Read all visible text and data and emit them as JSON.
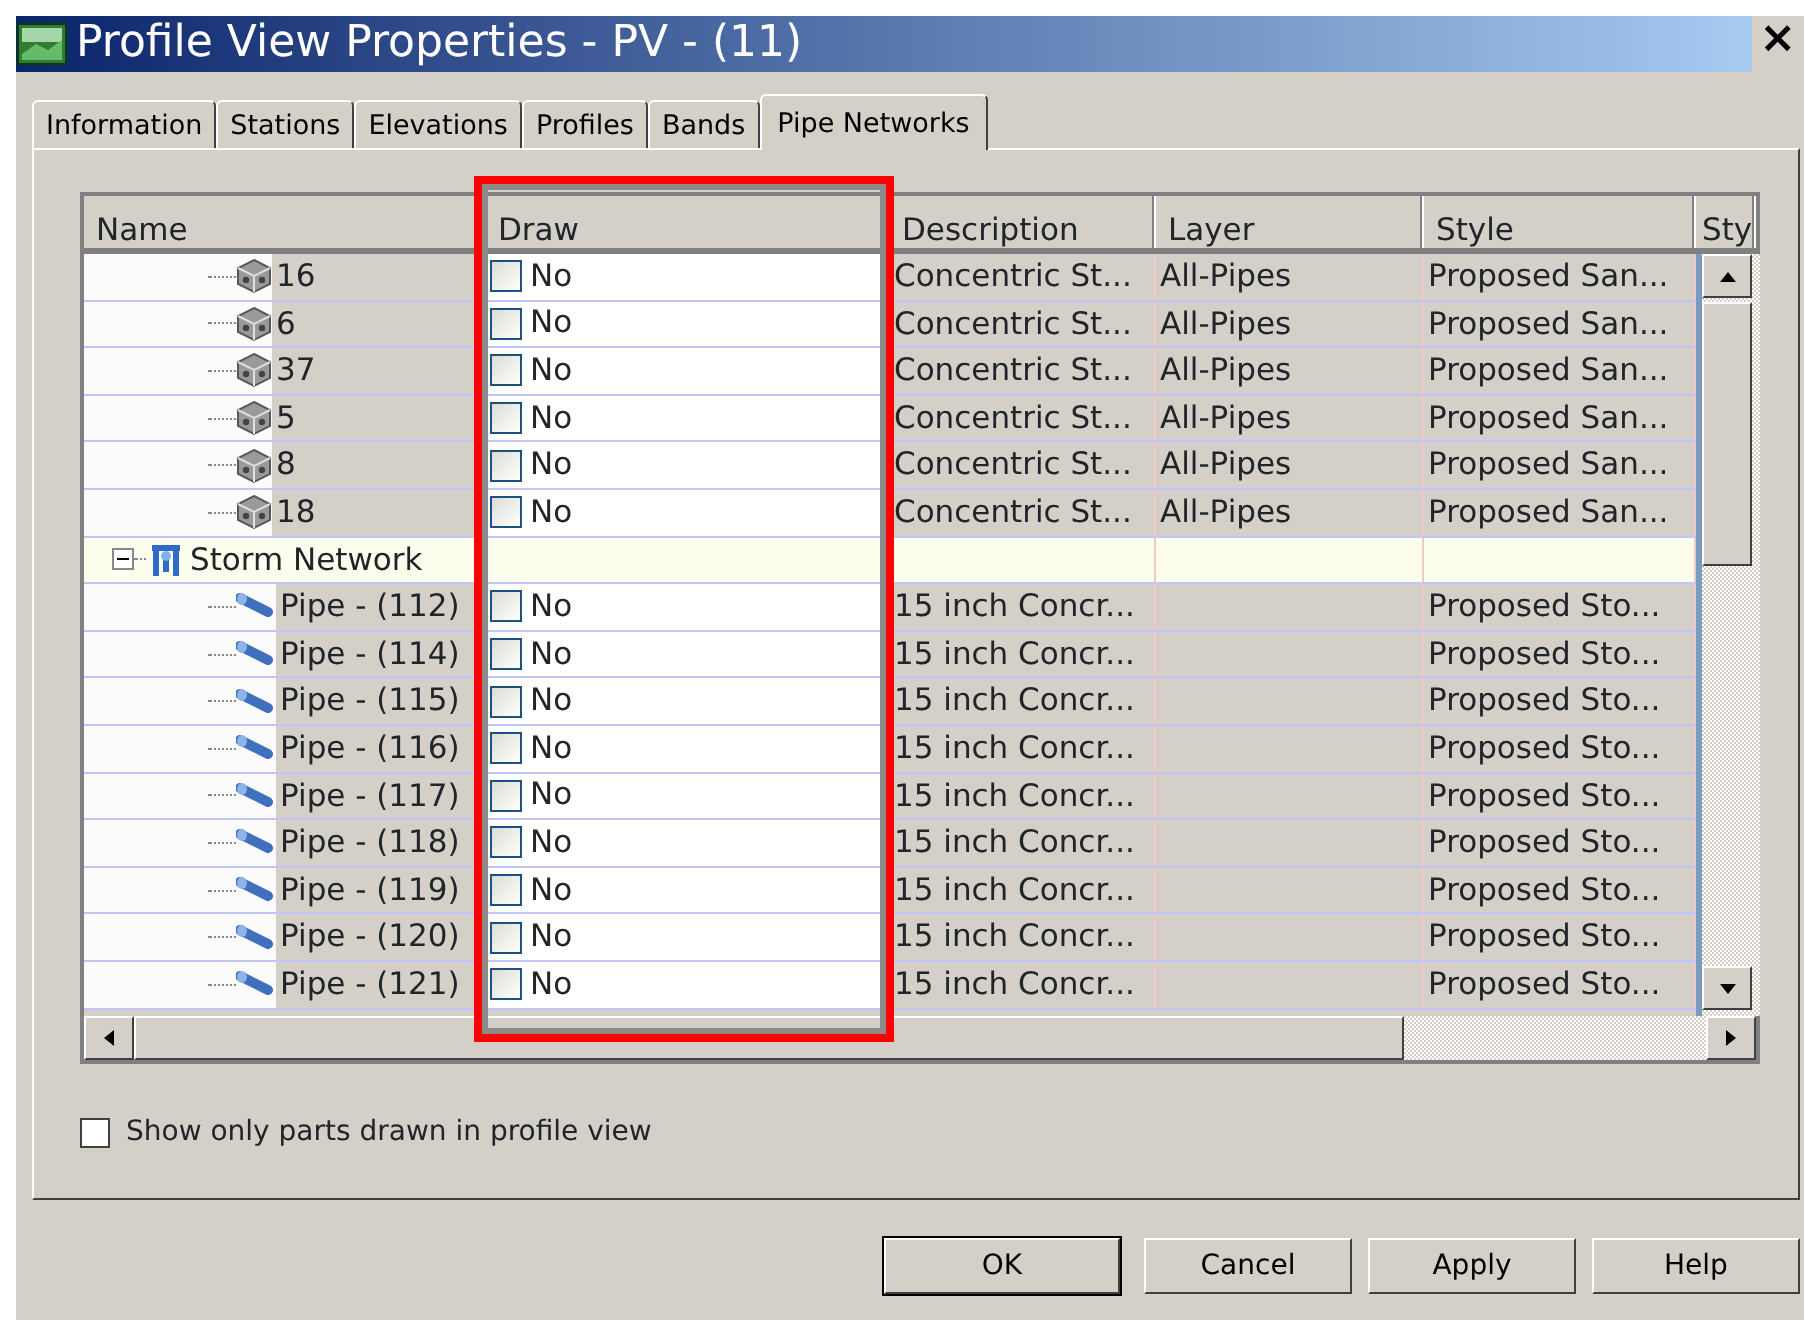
{
  "window": {
    "title": "Profile View Properties - PV - (11)",
    "close": "×"
  },
  "tabs": [
    {
      "label": "Information",
      "selected": false
    },
    {
      "label": "Stations",
      "selected": false
    },
    {
      "label": "Elevations",
      "selected": false
    },
    {
      "label": "Profiles",
      "selected": false
    },
    {
      "label": "Bands",
      "selected": false
    },
    {
      "label": "Pipe Networks",
      "selected": true
    }
  ],
  "table": {
    "columns": [
      {
        "label": "Name",
        "highlighted": false
      },
      {
        "label": "Draw",
        "highlighted": true
      },
      {
        "label": "Description",
        "highlighted": false
      },
      {
        "label": "Layer",
        "highlighted": false
      },
      {
        "label": "Style",
        "highlighted": false
      },
      {
        "label": "Sty",
        "highlighted": false
      }
    ],
    "tree": [
      {
        "children": [
          {
            "kind": "structure",
            "name": "16",
            "draw": {
              "checked": false,
              "label": "No"
            },
            "description": "Concentric St...",
            "layer": "All-Pipes",
            "style": "Proposed San..."
          },
          {
            "kind": "structure",
            "name": "6",
            "draw": {
              "checked": false,
              "label": "No"
            },
            "description": "Concentric St...",
            "layer": "All-Pipes",
            "style": "Proposed San..."
          },
          {
            "kind": "structure",
            "name": "37",
            "draw": {
              "checked": false,
              "label": "No"
            },
            "description": "Concentric St...",
            "layer": "All-Pipes",
            "style": "Proposed San..."
          },
          {
            "kind": "structure",
            "name": "5",
            "draw": {
              "checked": false,
              "label": "No"
            },
            "description": "Concentric St...",
            "layer": "All-Pipes",
            "style": "Proposed San..."
          },
          {
            "kind": "structure",
            "name": "8",
            "draw": {
              "checked": false,
              "label": "No"
            },
            "description": "Concentric St...",
            "layer": "All-Pipes",
            "style": "Proposed San..."
          },
          {
            "kind": "structure",
            "name": "18",
            "draw": {
              "checked": false,
              "label": "No"
            },
            "description": "Concentric St...",
            "layer": "All-Pipes",
            "style": "Proposed San..."
          }
        ]
      },
      {
        "kind": "network",
        "name": "Storm Network",
        "expanded": true,
        "children": [
          {
            "kind": "pipe",
            "name": "Pipe - (112)",
            "draw": {
              "checked": false,
              "label": "No"
            },
            "description": "15 inch Concr...",
            "style": "Proposed Sto..."
          },
          {
            "kind": "pipe",
            "name": "Pipe - (114)",
            "draw": {
              "checked": false,
              "label": "No"
            },
            "description": "15 inch Concr...",
            "style": "Proposed Sto..."
          },
          {
            "kind": "pipe",
            "name": "Pipe - (115)",
            "draw": {
              "checked": false,
              "label": "No"
            },
            "description": "15 inch Concr...",
            "style": "Proposed Sto..."
          },
          {
            "kind": "pipe",
            "name": "Pipe - (116)",
            "draw": {
              "checked": false,
              "label": "No"
            },
            "description": "15 inch Concr...",
            "style": "Proposed Sto..."
          },
          {
            "kind": "pipe",
            "name": "Pipe - (117)",
            "draw": {
              "checked": false,
              "label": "No"
            },
            "description": "15 inch Concr...",
            "style": "Proposed Sto..."
          },
          {
            "kind": "pipe",
            "name": "Pipe - (118)",
            "draw": {
              "checked": false,
              "label": "No"
            },
            "description": "15 inch Concr...",
            "style": "Proposed Sto..."
          },
          {
            "kind": "pipe",
            "name": "Pipe - (119)",
            "draw": {
              "checked": false,
              "label": "No"
            },
            "description": "15 inch Concr...",
            "style": "Proposed Sto..."
          },
          {
            "kind": "pipe",
            "name": "Pipe - (120)",
            "draw": {
              "checked": false,
              "label": "No"
            },
            "description": "15 inch Concr...",
            "style": "Proposed Sto..."
          },
          {
            "kind": "pipe",
            "name": "Pipe - (121)",
            "draw": {
              "checked": false,
              "label": "No"
            },
            "description": "15 inch Concr...",
            "style": "Proposed Sto..."
          }
        ]
      }
    ]
  },
  "options": [
    {
      "label": "Show only parts drawn in profile view",
      "checked": false
    }
  ],
  "buttons": [
    {
      "label": "OK",
      "default": true
    },
    {
      "label": "Cancel",
      "default": false
    },
    {
      "label": "Apply",
      "default": false
    },
    {
      "label": "Help",
      "default": false
    }
  ]
}
